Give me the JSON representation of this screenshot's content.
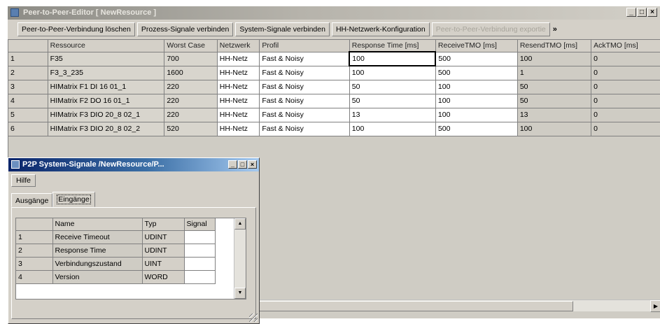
{
  "main_window": {
    "title": "Peer-to-Peer-Editor [ NewResource ]",
    "controls": {
      "minimize": "_",
      "maximize": "□",
      "close": "×"
    }
  },
  "toolbar": {
    "buttons": [
      {
        "label": "Peer-to-Peer-Verbindung löschen",
        "enabled": true
      },
      {
        "label": "Prozess-Signale verbinden",
        "enabled": true
      },
      {
        "label": "System-Signale verbinden",
        "enabled": true
      },
      {
        "label": "HH-Netzwerk-Konfiguration",
        "enabled": true
      },
      {
        "label": "Peer-to-Peer-Verbindung exportie",
        "enabled": false
      }
    ],
    "overflow": "»"
  },
  "grid": {
    "columns": [
      "",
      "Ressource",
      "Worst Case",
      "Netzwerk",
      "Profil",
      "Response Time [ms]",
      "ReceiveTMO [ms]",
      "ResendTMO [ms]",
      "AckTMO [ms]"
    ],
    "rows": [
      {
        "num": "1",
        "ressource": "F35",
        "worst_case": "700",
        "netzwerk": "HH-Netz",
        "profil": "Fast & Noisy",
        "response_time": "100",
        "receive_tmo": "500",
        "resend_tmo": "100",
        "ack_tmo": "0"
      },
      {
        "num": "2",
        "ressource": "F3_3_235",
        "worst_case": "1600",
        "netzwerk": "HH-Netz",
        "profil": "Fast & Noisy",
        "response_time": "100",
        "receive_tmo": "500",
        "resend_tmo": "1",
        "ack_tmo": "0"
      },
      {
        "num": "3",
        "ressource": "HIMatrix F1 DI 16 01_1",
        "worst_case": "220",
        "netzwerk": "HH-Netz",
        "profil": "Fast & Noisy",
        "response_time": "50",
        "receive_tmo": "100",
        "resend_tmo": "50",
        "ack_tmo": "0"
      },
      {
        "num": "4",
        "ressource": "HIMatrix F2 DO 16 01_1",
        "worst_case": "220",
        "netzwerk": "HH-Netz",
        "profil": "Fast & Noisy",
        "response_time": "50",
        "receive_tmo": "100",
        "resend_tmo": "50",
        "ack_tmo": "0"
      },
      {
        "num": "5",
        "ressource": "HIMatrix F3 DIO 20_8 02_1",
        "worst_case": "220",
        "netzwerk": "HH-Netz",
        "profil": "Fast & Noisy",
        "response_time": "13",
        "receive_tmo": "100",
        "resend_tmo": "13",
        "ack_tmo": "0"
      },
      {
        "num": "6",
        "ressource": "HIMatrix F3 DIO 20_8 02_2",
        "worst_case": "520",
        "netzwerk": "HH-Netz",
        "profil": "Fast & Noisy",
        "response_time": "100",
        "receive_tmo": "500",
        "resend_tmo": "100",
        "ack_tmo": "0"
      }
    ]
  },
  "child_window": {
    "title": "P2P System-Signale /NewResource/P...",
    "menu": {
      "hilfe": "Hilfe"
    },
    "tabs": [
      {
        "label": "Ausgänge",
        "active": false
      },
      {
        "label": "Eingänge",
        "active": true
      }
    ],
    "signal_grid": {
      "columns": [
        "",
        "Name",
        "Typ",
        "Signal"
      ],
      "rows": [
        {
          "num": "1",
          "name": "Receive Timeout",
          "typ": "UDINT",
          "signal": ""
        },
        {
          "num": "2",
          "name": "Response Time",
          "typ": "UDINT",
          "signal": ""
        },
        {
          "num": "3",
          "name": "Verbindungszustand",
          "typ": "UINT",
          "signal": ""
        },
        {
          "num": "4",
          "name": "Version",
          "typ": "WORD",
          "signal": ""
        }
      ]
    }
  }
}
